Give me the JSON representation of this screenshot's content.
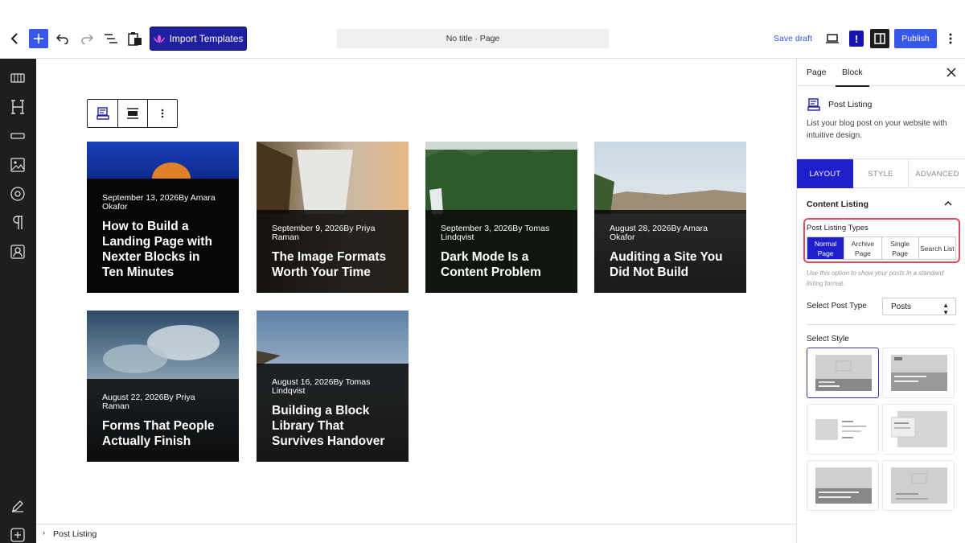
{
  "topbar": {
    "import_label": "Import Templates",
    "doc_title": "No title · Page",
    "save_label": "Save draft",
    "excl_label": "!",
    "publish_label": "Publish"
  },
  "posts": [
    {
      "meta": "September 13, 2026By Amara Okafor",
      "title": "How to Build a Landing Page with Nexter Blocks in Ten Minutes"
    },
    {
      "meta": "September 9, 2026By Priya Raman",
      "title": "The Image Formats Worth Your Time"
    },
    {
      "meta": "September 3, 2026By Tomas Lindqvist",
      "title": "Dark Mode Is a Content Problem"
    },
    {
      "meta": "August 28, 2026By Amara Okafor",
      "title": "Auditing a Site You Did Not Build"
    },
    {
      "meta": "August 22, 2026By Priya Raman",
      "title": "Forms That People Actually Finish"
    },
    {
      "meta": "August 16, 2026By Tomas Lindqvist",
      "title": "Building a Block Library That Survives Handover"
    }
  ],
  "breadcrumb": {
    "label": "Post Listing"
  },
  "sidebar": {
    "tab_page": "Page",
    "tab_block": "Block",
    "block_name": "Post Listing",
    "block_desc": "List your blog post on your website with intuitive design.",
    "tab_layout": "LAYOUT",
    "tab_style": "STYLE",
    "tab_advanced": "ADVANCED",
    "section_title": "Content Listing",
    "types_label": "Post Listing Types",
    "types": [
      "Normal Page",
      "Archive Page",
      "Single Page",
      "Search List"
    ],
    "types_help": "Use this option to show your posts in a standard listing format.",
    "post_type_label": "Select Post Type",
    "post_type_value": "Posts",
    "style_label": "Select Style"
  },
  "colors": {
    "accent": "#3858e9",
    "active_tab": "#1f1fcc",
    "import_bg": "#1f1fa0",
    "highlight": "#e04b5e"
  }
}
